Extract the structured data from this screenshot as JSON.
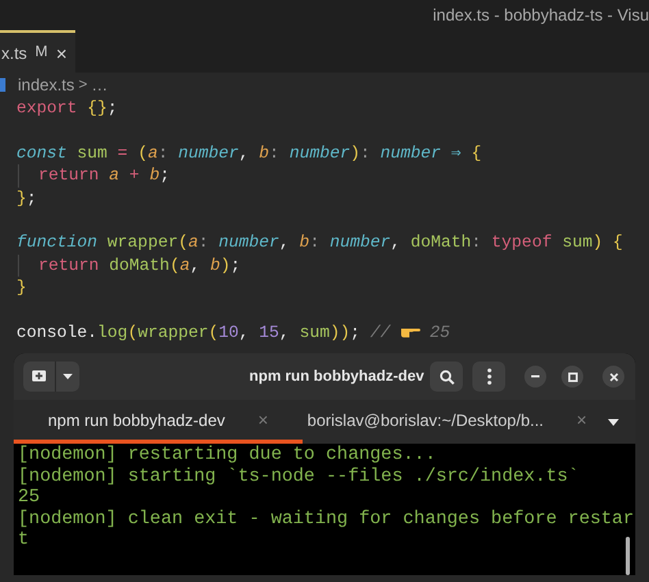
{
  "window": {
    "title": "index.ts - bobbyhadz-ts - Visu"
  },
  "editor_tab": {
    "label": "x.ts",
    "badge": "M",
    "close": "×"
  },
  "breadcrumb": {
    "file": "index.ts",
    "separator": ">",
    "rest": "…"
  },
  "code": [
    {
      "kind": "code",
      "tokens": [
        {
          "t": "export ",
          "kind": "kw"
        },
        {
          "t": "{}",
          "kind": "brace"
        },
        {
          "t": ";",
          "kind": "plain"
        }
      ]
    },
    {
      "kind": "blank"
    },
    {
      "kind": "code",
      "tokens": [
        {
          "t": "const ",
          "kind": "storage"
        },
        {
          "t": "sum",
          "kind": "fn"
        },
        {
          "t": " = ",
          "kind": "op"
        },
        {
          "t": "(",
          "kind": "brace"
        },
        {
          "t": "a",
          "kind": "param"
        },
        {
          "t": ": ",
          "kind": "punct"
        },
        {
          "t": "number",
          "kind": "type"
        },
        {
          "t": ", ",
          "kind": "plain"
        },
        {
          "t": "b",
          "kind": "param"
        },
        {
          "t": ": ",
          "kind": "punct"
        },
        {
          "t": "number",
          "kind": "type"
        },
        {
          "t": ")",
          "kind": "brace"
        },
        {
          "t": ": ",
          "kind": "punct"
        },
        {
          "t": "number",
          "kind": "type"
        },
        {
          "t": " ⇒ ",
          "kind": "arrow"
        },
        {
          "t": "{",
          "kind": "brace"
        }
      ],
      "children": [
        {
          "kind": "code",
          "tokens": [
            {
              "t": "return ",
              "kind": "kw"
            },
            {
              "t": "a",
              "kind": "param"
            },
            {
              "t": " + ",
              "kind": "op"
            },
            {
              "t": "b",
              "kind": "param"
            },
            {
              "t": ";",
              "kind": "plain"
            }
          ]
        }
      ]
    },
    {
      "kind": "code",
      "tokens": [
        {
          "t": "}",
          "kind": "brace"
        },
        {
          "t": ";",
          "kind": "plain"
        }
      ]
    },
    {
      "kind": "blank"
    },
    {
      "kind": "code",
      "tokens": [
        {
          "t": "function ",
          "kind": "storage"
        },
        {
          "t": "wrapper",
          "kind": "fn"
        },
        {
          "t": "(",
          "kind": "brace"
        },
        {
          "t": "a",
          "kind": "param"
        },
        {
          "t": ": ",
          "kind": "punct"
        },
        {
          "t": "number",
          "kind": "type"
        },
        {
          "t": ", ",
          "kind": "plain"
        },
        {
          "t": "b",
          "kind": "param"
        },
        {
          "t": ": ",
          "kind": "punct"
        },
        {
          "t": "number",
          "kind": "type"
        },
        {
          "t": ", ",
          "kind": "plain"
        },
        {
          "t": "doMath",
          "kind": "fn"
        },
        {
          "t": ": ",
          "kind": "punct"
        },
        {
          "t": "typeof ",
          "kind": "kw"
        },
        {
          "t": "sum",
          "kind": "fn"
        },
        {
          "t": ") ",
          "kind": "brace"
        },
        {
          "t": "{",
          "kind": "brace"
        }
      ],
      "children": [
        {
          "kind": "code",
          "tokens": [
            {
              "t": "return ",
              "kind": "kw"
            },
            {
              "t": "doMath",
              "kind": "fn"
            },
            {
              "t": "(",
              "kind": "brace"
            },
            {
              "t": "a",
              "kind": "param"
            },
            {
              "t": ", ",
              "kind": "plain"
            },
            {
              "t": "b",
              "kind": "param"
            },
            {
              "t": ")",
              "kind": "brace"
            },
            {
              "t": ";",
              "kind": "plain"
            }
          ]
        }
      ]
    },
    {
      "kind": "code",
      "tokens": [
        {
          "t": "}",
          "kind": "brace"
        }
      ]
    },
    {
      "kind": "blank"
    },
    {
      "kind": "code",
      "tokens": [
        {
          "t": "console",
          "kind": "plain"
        },
        {
          "t": ".",
          "kind": "plain"
        },
        {
          "t": "log",
          "kind": "fn"
        },
        {
          "t": "(",
          "kind": "brace"
        },
        {
          "t": "wrapper",
          "kind": "fn"
        },
        {
          "t": "(",
          "kind": "brace"
        },
        {
          "t": "10",
          "kind": "num"
        },
        {
          "t": ", ",
          "kind": "plain"
        },
        {
          "t": "15",
          "kind": "num"
        },
        {
          "t": ", ",
          "kind": "plain"
        },
        {
          "t": "sum",
          "kind": "fn"
        },
        {
          "t": "))",
          "kind": "brace"
        },
        {
          "t": "; ",
          "kind": "plain"
        },
        {
          "t": "// ",
          "kind": "comment"
        },
        {
          "kind": "hand"
        },
        {
          "t": " 25",
          "kind": "comment"
        }
      ]
    }
  ],
  "terminal": {
    "title": "npm run bobbyhadz-dev",
    "tabs": [
      {
        "label": "npm run bobbyhadz-dev",
        "close": "×",
        "selected": true
      },
      {
        "label": "borislav@borislav:~/Desktop/b...",
        "close": "×",
        "selected": false
      }
    ],
    "lines": [
      "[nodemon] restarting due to changes...",
      "[nodemon] starting `ts-node --files ./src/index.ts`",
      "25",
      "[nodemon] clean exit - waiting for changes before restar",
      "t"
    ]
  }
}
